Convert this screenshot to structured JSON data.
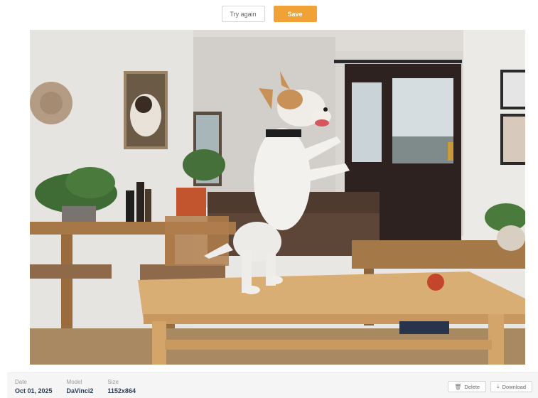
{
  "toolbar": {
    "try_again_label": "Try again",
    "save_label": "Save"
  },
  "colors": {
    "save_accent": "#f0a237",
    "meta_value": "#2b3d55"
  },
  "image": {
    "subject": "terrier-dog-on-table"
  },
  "footer": {
    "date_label": "Date",
    "date_value": "Oct 01, 2025",
    "model_label": "Model",
    "model_value": "DaVinci2",
    "size_label": "Size",
    "size_value": "1152x864",
    "delete_label": "Delete",
    "delete_icon": "trash-icon",
    "download_label": "Download",
    "download_icon": "download-icon"
  }
}
